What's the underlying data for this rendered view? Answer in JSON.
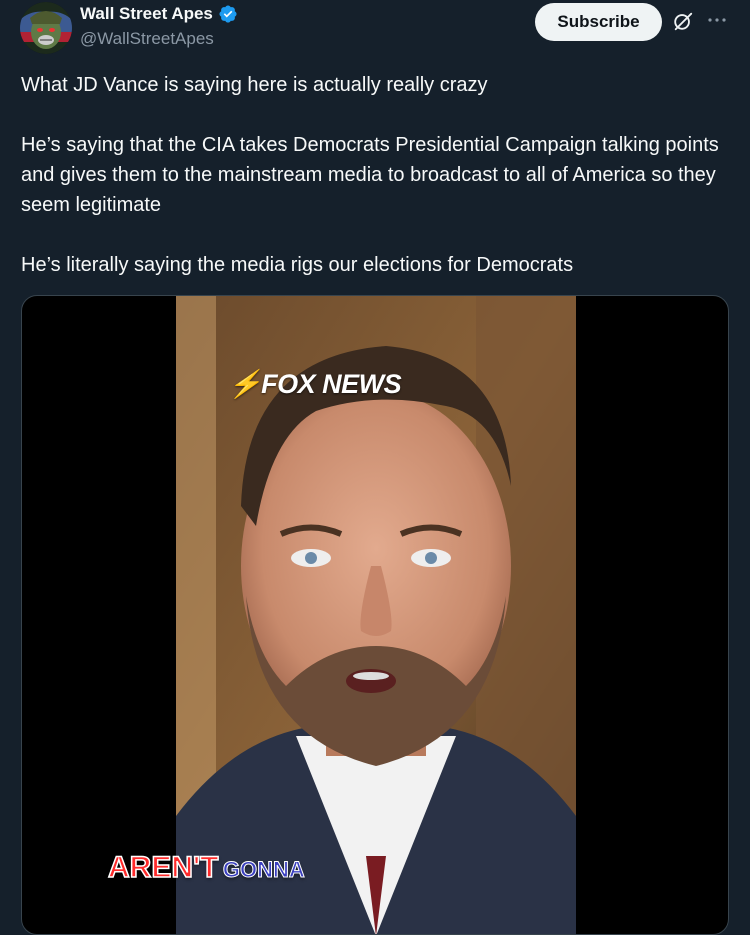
{
  "author": {
    "display_name": "Wall Street Apes",
    "handle": "@WallStreetApes",
    "verified": true,
    "avatar_icon": "ape-avatar"
  },
  "actions": {
    "subscribe_label": "Subscribe",
    "grok_icon": "grok-icon",
    "more_icon": "more-icon"
  },
  "tweet": {
    "paragraphs": [
      "What JD Vance is saying here is actually really crazy",
      "He’s saying that the CIA takes Democrats Presidential Campaign talking points and gives them to the mainstream media to broadcast to all of America so they seem legitimate",
      "He’s literally saying the media rigs our elections for Democrats"
    ]
  },
  "media": {
    "type": "video",
    "logo_text": "FOX NEWS",
    "caption_word1": "AREN'T",
    "caption_word2": "GONNA"
  },
  "colors": {
    "background": "#15202b",
    "text": "#f7f9f9",
    "secondary_text": "#8b98a5",
    "verified_blue": "#1d9bf0",
    "button_bg": "#eff3f4"
  }
}
